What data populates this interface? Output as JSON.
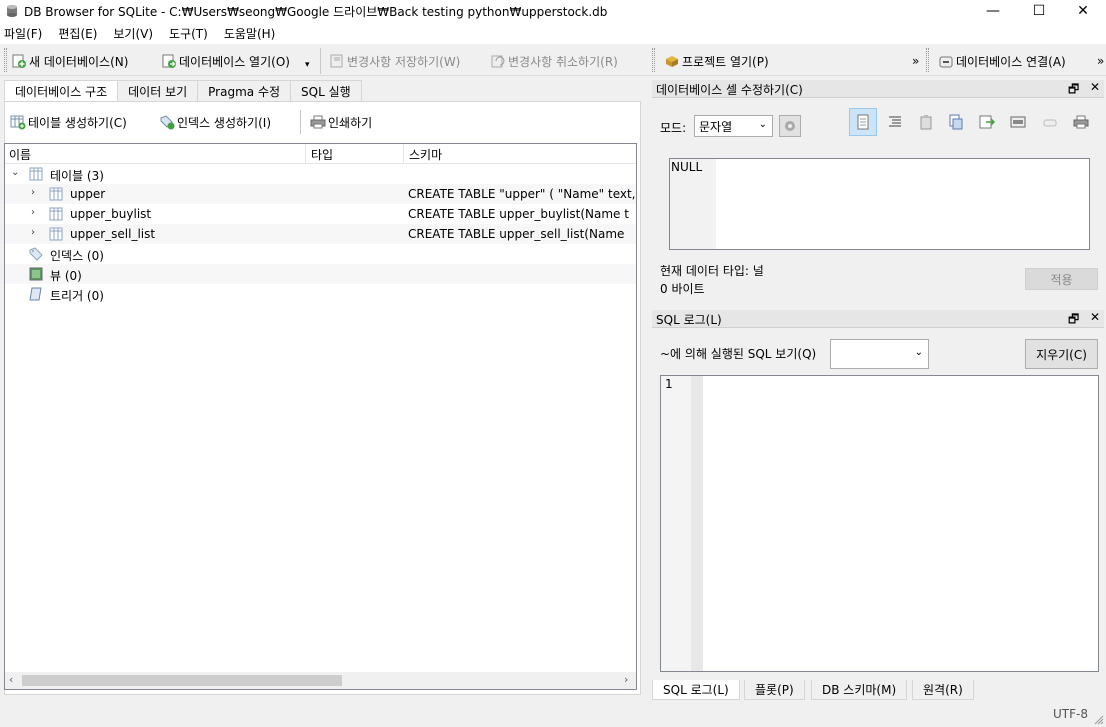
{
  "window": {
    "title": "DB Browser for SQLite - C:₩Users₩seong₩Google 드라이브₩Back testing python₩upperstock.db",
    "minimize": "—",
    "maximize": "☐",
    "close": "✕"
  },
  "menu": [
    "파일(F)",
    "편집(E)",
    "보기(V)",
    "도구(T)",
    "도움말(H)"
  ],
  "toolbar": {
    "new_db": "새 데이터베이스(N)",
    "open_db": "데이터베이스 열기(O)",
    "write_changes": "변경사항 저장하기(W)",
    "revert_changes": "변경사항 취소하기(R)",
    "open_project": "프로젝트 열기(P)",
    "overflow": "»",
    "attach_db": "데이터베이스 연결(A)",
    "overflow2": "»"
  },
  "left": {
    "tabs": [
      "데이터베이스 구조",
      "데이터 보기",
      "Pragma 수정",
      "SQL 실행"
    ],
    "buttons": {
      "create_table": "테이블 생성하기(C)",
      "create_index": "인덱스 생성하기(I)",
      "print": "인쇄하기"
    },
    "columns": [
      "이름",
      "타입",
      "스키마"
    ],
    "tree": {
      "tables": "테이블 (3)",
      "items": [
        {
          "name": "upper",
          "schema": "CREATE TABLE \"upper\" ( \"Name\" text,"
        },
        {
          "name": "upper_buylist",
          "schema": "CREATE TABLE upper_buylist(Name t"
        },
        {
          "name": "upper_sell_list",
          "schema": "CREATE TABLE upper_sell_list(Name"
        }
      ],
      "indices": "인덱스 (0)",
      "views": "뷰 (0)",
      "triggers": "트리거 (0)"
    }
  },
  "edit_cell": {
    "title": "데이터베이스 셀 수정하기(C)",
    "mode_label": "모드:",
    "mode_value": "문자열",
    "content": "NULL",
    "type_label": "현재 데이터 타입: 널",
    "size_label": "0 바이트",
    "apply": "적용"
  },
  "sql_log": {
    "title": "SQL 로그(L)",
    "submitted_label": "~에 의해 실행된 SQL 보기(Q)",
    "clear": "지우기(C)",
    "line_number": "1"
  },
  "bottom_tabs": [
    "SQL 로그(L)",
    "플롯(P)",
    "DB 스키마(M)",
    "원격(R)"
  ],
  "status": {
    "encoding": "UTF-8"
  },
  "dock_buttons": {
    "float": "🗗",
    "close": "✕"
  }
}
